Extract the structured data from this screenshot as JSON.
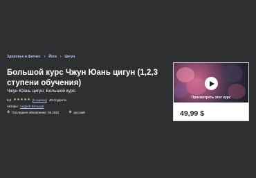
{
  "breadcrumb": {
    "items": [
      "Здоровье и фитнес",
      "Йога",
      "Цигун"
    ],
    "separator": "›"
  },
  "course": {
    "title": "Большой курс Чжун Юань цигун (1,2,3 ступени обучения)",
    "subtitle": "Чжун Юань цигун. Большой курс.",
    "rating": "5,0",
    "stars": [
      "★",
      "★",
      "★",
      "★",
      "★"
    ],
    "reviews": "(5 оценок)",
    "students": "40 студента",
    "authors_label": "Авторы:",
    "author": "Андрей Бельцов",
    "updated": "Последнее обновление: 05.2022",
    "language": "русский",
    "updated_icon": "⊛",
    "language_icon": "⊕"
  },
  "card": {
    "preview_label": "Просмотреть этот курс",
    "price": "49,99 $"
  },
  "colors": {
    "background": "#2d2f31",
    "link": "#c0c4fc",
    "star": "#f3ca8c",
    "card": "#ffffff"
  }
}
